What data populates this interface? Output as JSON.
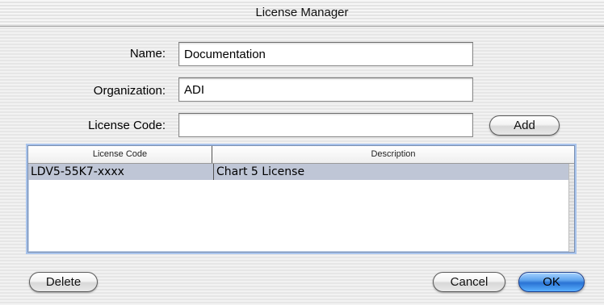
{
  "window": {
    "title": "License Manager"
  },
  "form": {
    "name_label": "Name:",
    "name_value": "Documentation",
    "organization_label": "Organization:",
    "organization_value": "ADI",
    "license_code_label": "License Code:",
    "license_code_value": "",
    "add_label": "Add"
  },
  "table": {
    "columns": [
      "License Code",
      "Description"
    ],
    "rows": [
      {
        "code": "LDV5-55K7-xxxx",
        "description": "Chart 5 License",
        "selected": true
      }
    ]
  },
  "buttons": {
    "delete_label": "Delete",
    "cancel_label": "Cancel",
    "ok_label": "OK"
  },
  "colors": {
    "selected_row": "#bfc6d6",
    "default_button": "#2a73d4",
    "table_focus_ring": "#a9c4ec"
  }
}
